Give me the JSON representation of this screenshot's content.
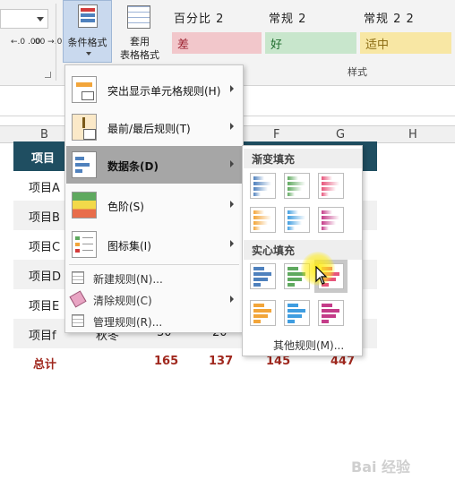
{
  "ribbon": {
    "decimal_increase_label": "←.0 .00",
    "decimal_decrease_label": ".00 →.0",
    "conditional_format_label": "条件格式",
    "table_format_line1": "套用",
    "table_format_line2": "表格格式",
    "styles": [
      {
        "name": "百分比 2"
      },
      {
        "name": "常规 2"
      },
      {
        "name": "常规 2 2"
      }
    ],
    "style_cells": [
      {
        "label": "差",
        "bg": "#f2c7cb",
        "fg": "#9c2230"
      },
      {
        "label": "好",
        "bg": "#c8e6cc",
        "fg": "#1e6b2c"
      },
      {
        "label": "适中",
        "bg": "#f8e7a4",
        "fg": "#8c6d14"
      }
    ],
    "styles_group_label": "样式"
  },
  "columns": [
    "B",
    "F",
    "G",
    "H"
  ],
  "sheet": {
    "header_label": "项目",
    "rows": [
      "项目A",
      "项目B",
      "项目C",
      "项目D",
      "项目E",
      "项目f"
    ],
    "f_row_extra": [
      "秋冬",
      "30",
      "20"
    ],
    "total_label": "总计",
    "totals": [
      "165",
      "137",
      "145",
      "447"
    ]
  },
  "menu": {
    "items": [
      {
        "label": "突出显示单元格规则(H)"
      },
      {
        "label": "最前/最后规则(T)"
      },
      {
        "label": "数据条(D)"
      },
      {
        "label": "色阶(S)"
      },
      {
        "label": "图标集(I)"
      }
    ],
    "small_items": [
      {
        "label": "新建规则(N)..."
      },
      {
        "label": "清除规则(C)"
      },
      {
        "label": "管理规则(R)..."
      }
    ]
  },
  "submenu": {
    "gradient_header": "渐变填充",
    "solid_header": "实心填充",
    "more_rules": "其他规则(M)...",
    "bar_colors": [
      "#4f81bd",
      "#5fa95f",
      "#e7557b",
      "#f2a53a",
      "#3f9de0",
      "#c43c89"
    ]
  },
  "watermark": "Bai 经验"
}
